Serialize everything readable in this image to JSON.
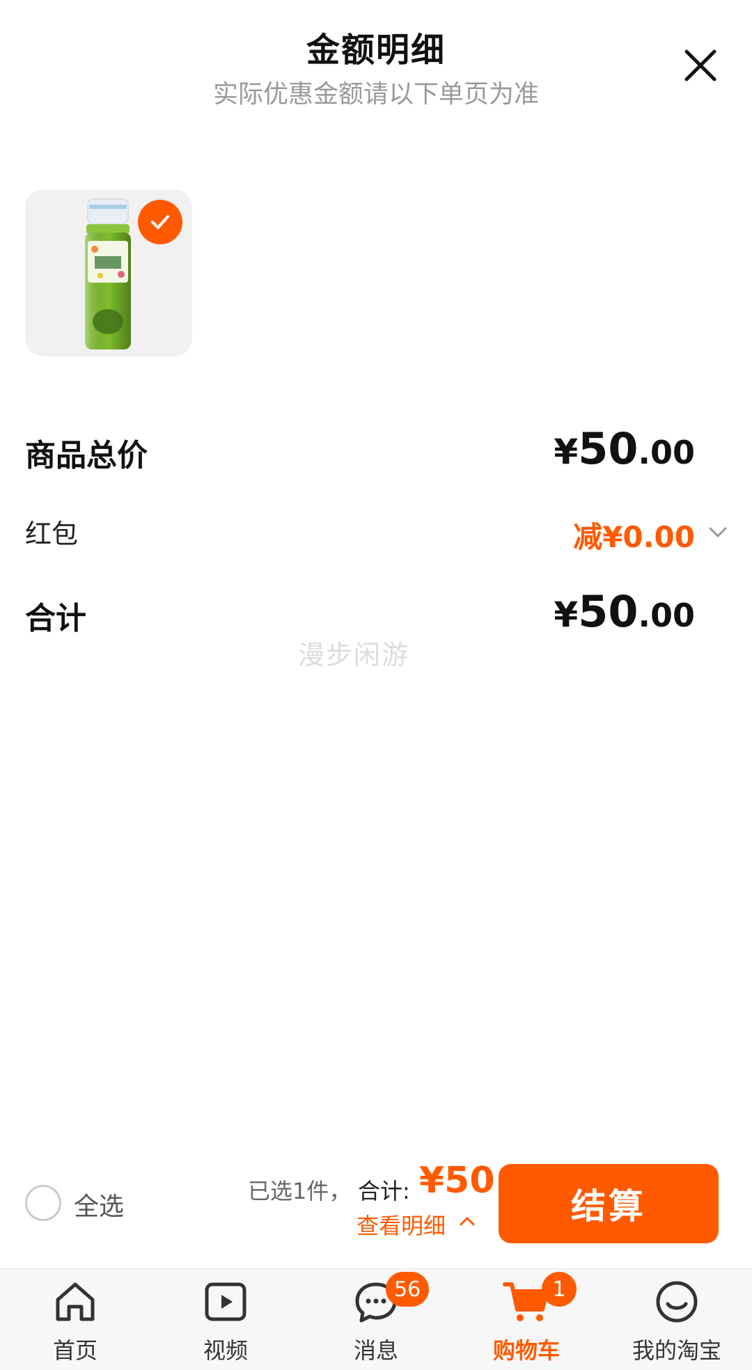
{
  "header": {
    "title": "金额明细",
    "subtitle": "实际优惠金额请以下单页为准"
  },
  "summary": {
    "subtotal_label": "商品总价",
    "subtotal_int": "50",
    "subtotal_dec": ".00",
    "redpacket_label": "红包",
    "redpacket_value": "减¥0.00",
    "total_label": "合计",
    "total_int": "50",
    "total_dec": ".00",
    "currency": "¥"
  },
  "watermark": "漫步闲游",
  "checkout": {
    "select_all_label": "全选",
    "selected_count": "已选1件，",
    "total_label": "合计:",
    "total_amount": "¥50",
    "view_detail": "查看明细",
    "button_label": "结算"
  },
  "nav": {
    "items": [
      {
        "label": "首页",
        "icon": "home-icon",
        "active": false
      },
      {
        "label": "视频",
        "icon": "video-icon",
        "active": false
      },
      {
        "label": "消息",
        "icon": "message-icon",
        "active": false,
        "badge": "56"
      },
      {
        "label": "购物车",
        "icon": "cart-icon",
        "active": true,
        "badge": "1"
      },
      {
        "label": "我的淘宝",
        "icon": "my-taobao-icon",
        "active": false
      }
    ]
  },
  "colors": {
    "accent": "#ff5a00",
    "text": "#111111",
    "muted": "#9a9a9a"
  }
}
